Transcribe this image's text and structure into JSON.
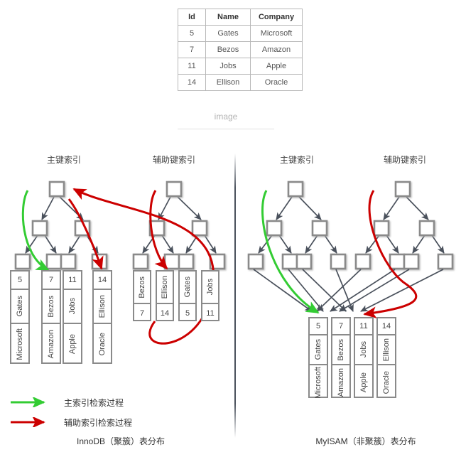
{
  "record_table": {
    "columns": [
      "Id",
      "Name",
      "Company"
    ],
    "rows": [
      [
        "5",
        "Gates",
        "Microsoft"
      ],
      [
        "7",
        "Bezos",
        "Amazon"
      ],
      [
        "11",
        "Jobs",
        "Apple"
      ],
      [
        "14",
        "Ellison",
        "Oracle"
      ]
    ]
  },
  "image_placeholder": "image",
  "panels": {
    "left": {
      "primary_title": "主键索引",
      "secondary_title": "辅助键索引",
      "caption": "InnoDB（聚簇）表分布",
      "primary_data_columns": [
        {
          "id": "5",
          "name": "Gates",
          "company": "Microsoft"
        },
        {
          "id": "7",
          "name": "Bezos",
          "company": "Amazon"
        },
        {
          "id": "11",
          "name": "Jobs",
          "company": "Apple"
        },
        {
          "id": "14",
          "name": "Ellison",
          "company": "Oracle"
        }
      ],
      "secondary_data_columns": [
        {
          "name": "Bezos",
          "id": "7"
        },
        {
          "name": "Ellison",
          "id": "14"
        },
        {
          "name": "Gates",
          "id": "5"
        },
        {
          "name": "Jobs",
          "id": "11"
        }
      ]
    },
    "right": {
      "primary_title": "主键索引",
      "secondary_title": "辅助键索引",
      "caption": "MyISAM（非聚簇）表分布",
      "data_columns": [
        {
          "id": "5",
          "name": "Gates",
          "company": "Microsoft"
        },
        {
          "id": "7",
          "name": "Bezos",
          "company": "Amazon"
        },
        {
          "id": "11",
          "name": "Jobs",
          "company": "Apple"
        },
        {
          "id": "14",
          "name": "Ellison",
          "company": "Oracle"
        }
      ]
    }
  },
  "legend": {
    "items": [
      {
        "label": "主索引检索过程",
        "color": "#33cc33"
      },
      {
        "label": "辅助索引检索过程",
        "color": "#cc0000"
      }
    ]
  },
  "colors": {
    "node_border": "#8a8a8a",
    "edge": "#4a515c",
    "primary_path": "#33cc33",
    "secondary_path": "#cc0000",
    "divider": "#4a515c"
  }
}
